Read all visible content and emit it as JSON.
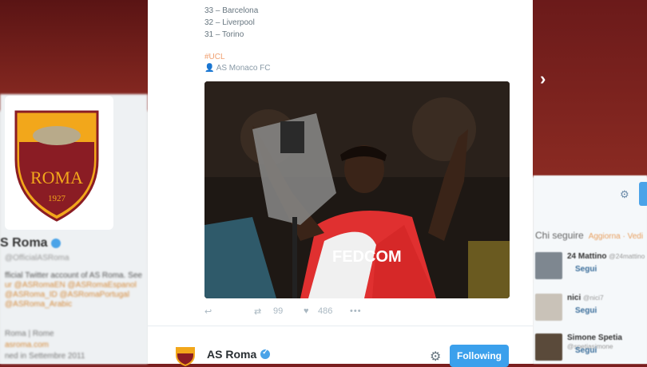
{
  "background_profile": {
    "name": "S Roma",
    "handle": "@OfficialASRoma",
    "bio_lines": [
      "fficial Twitter account of AS Roma. See",
      "ur @ASRomaEN @ASRomaEspanol",
      "@ASRoma_ID @ASRomaPortugal",
      "@ASRoma_Arabic"
    ],
    "meta_lines": [
      "Roma | Rome",
      "asroma.com",
      "ned in Settembre 2011"
    ],
    "crest_text": "ROMA",
    "crest_year": "1927"
  },
  "who_to_follow": {
    "title": "Chi seguire",
    "refresh": "Aggiorna · Vedi",
    "items": [
      {
        "name": "24 Mattino",
        "handle": "@24mattino",
        "follow": "Segui"
      },
      {
        "name": "nici",
        "handle": "@nici7",
        "follow": "Segui"
      },
      {
        "name": "Simone Spetia",
        "handle": "@spetiasimone",
        "follow": "Segui"
      }
    ]
  },
  "tweet": {
    "ranking": [
      "33 – Barcelona",
      "32 – Liverpool",
      "31 – Torino"
    ],
    "location": "#UCL",
    "team_tag": "AS Monaco FC",
    "image_text": "FEDCOM",
    "counts": {
      "retweets": "99",
      "likes": "486"
    },
    "icons": [
      "reply-icon",
      "retweet-icon",
      "heart-icon",
      "more-icon"
    ]
  },
  "footer": {
    "account_name": "AS Roma",
    "follow_label": "Following"
  },
  "colors": {
    "accent": "#3ba0ec",
    "roma_red": "#8a1c24",
    "roma_gold": "#f2a71b"
  }
}
